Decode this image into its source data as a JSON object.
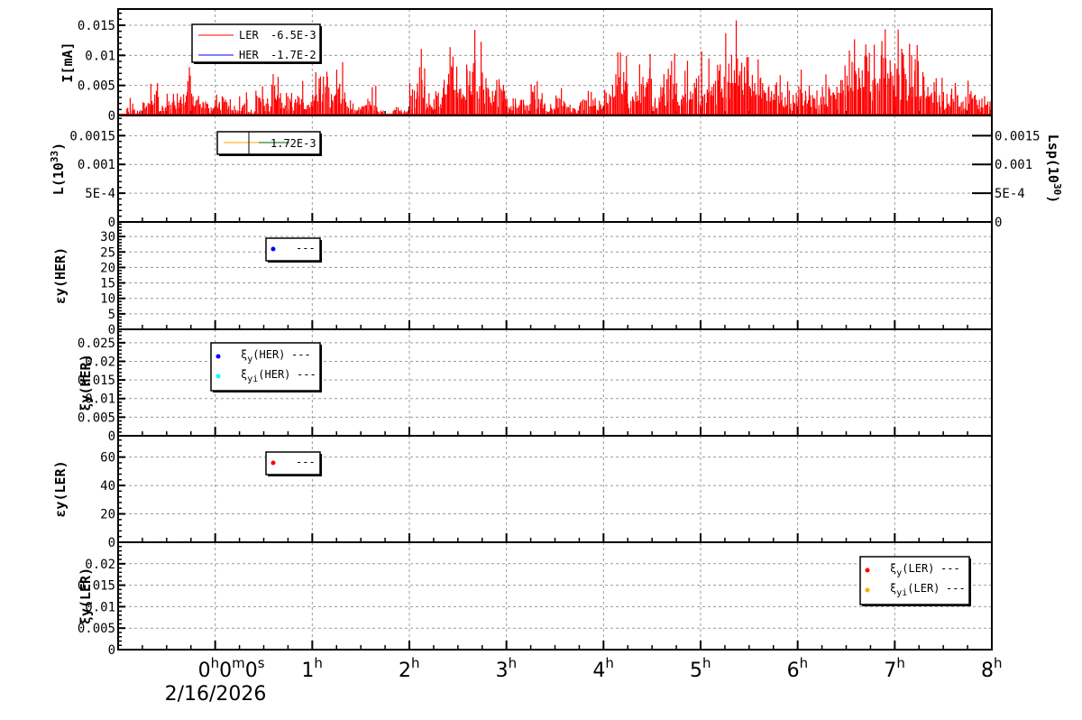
{
  "chart_data": [
    {
      "type": "bar",
      "ylabel": "I[mA]",
      "ylim": [
        0,
        0.0177
      ],
      "yticks": [
        "0",
        "0.005",
        "0.01",
        "0.015"
      ],
      "ytick_values": [
        0,
        0.005,
        0.01,
        0.015
      ],
      "legend": [
        {
          "name": "LER",
          "value": "-6.5E-3",
          "color": "#ff0000"
        },
        {
          "name": "HER",
          "value": "-1.7E-2",
          "color": "#0000ff"
        }
      ],
      "x_start_h": -1,
      "bin_minutes": 5,
      "values": [
        0,
        0.003,
        0.001,
        0.004,
        0.006,
        0.002,
        0.004,
        0.006,
        0.01,
        0.005,
        0.003,
        0.002,
        0.005,
        0.004,
        0.002,
        0.004,
        0.001,
        0.006,
        0.003,
        0.01,
        0.005,
        0.004,
        0.006,
        0.003,
        0.008,
        0.011,
        0.006,
        0.009,
        0.004,
        0.002,
        0.003,
        0.005,
        0.001,
        0,
        0.002,
        0.001,
        0.006,
        0.013,
        0.004,
        0.006,
        0.009,
        0.012,
        0.008,
        0.013,
        0.015,
        0.01,
        0.006,
        0.008,
        0.003,
        0.004,
        0.003,
        0.006,
        0.004,
        0.002,
        0.005,
        0.003,
        0.002,
        0.004,
        0.005,
        0.003,
        0.007,
        0.011,
        0.012,
        0.006,
        0.009,
        0.012,
        0.004,
        0.007,
        0.011,
        0.006,
        0.01,
        0.008,
        0.012,
        0.01,
        0.011,
        0.016,
        0.017,
        0.014,
        0.009,
        0.012,
        0.007,
        0.008,
        0.006,
        0.004,
        0.009,
        0.008,
        0.005,
        0.007,
        0.006,
        0.01,
        0.013,
        0.015,
        0.017,
        0.013,
        0.015,
        0.011,
        0.015,
        0.012,
        0.014,
        0.01,
        0.006,
        0.008,
        0.005,
        0.007,
        0.004,
        0.006,
        0.003,
        0.004
      ]
    },
    {
      "type": "line",
      "ylabel": "L(10",
      "ylabel_sup": "33",
      "ylabel_end": ")",
      "ylim": [
        0,
        0.00185
      ],
      "yticks": [
        "0",
        "5E-4",
        "0.001",
        "0.0015"
      ],
      "ytick_values": [
        0,
        0.0005,
        0.001,
        0.0015
      ],
      "ylabel_right": "Lsp(10",
      "ylabel_right_sup": "30",
      "ylabel_right_end": ")",
      "legend": [
        {
          "name": "",
          "value": "1.72E-3",
          "color": "#ffaa00"
        }
      ]
    },
    {
      "type": "scatter",
      "ylabel": "εy(HER)",
      "ylim": [
        0,
        34.7
      ],
      "yticks": [
        "0",
        "5",
        "10",
        "15",
        "20",
        "25",
        "30"
      ],
      "ytick_values": [
        0,
        5,
        10,
        15,
        20,
        25,
        30
      ],
      "legend": [
        {
          "name": "",
          "value": "---",
          "color": "#0000ff"
        }
      ]
    },
    {
      "type": "scatter",
      "ylabel": "ξy(HER)",
      "ylim": [
        0,
        0.0286
      ],
      "yticks": [
        "0",
        "0.005",
        "0.01",
        "0.015",
        "0.02",
        "0.025"
      ],
      "ytick_values": [
        0,
        0.005,
        0.01,
        0.015,
        0.02,
        0.025
      ],
      "legend": [
        {
          "name": "ξy(HER)",
          "value": "---",
          "color": "#0000ff"
        },
        {
          "name": "ξyi(HER)",
          "value": "---",
          "color": "#00ffff"
        }
      ]
    },
    {
      "type": "scatter",
      "ylabel": "εy(LER)",
      "ylim": [
        0,
        75
      ],
      "yticks": [
        "0",
        "20",
        "40",
        "60"
      ],
      "ytick_values": [
        0,
        20,
        40,
        60
      ],
      "legend": [
        {
          "name": "",
          "value": "---",
          "color": "#ff0000"
        }
      ]
    },
    {
      "type": "scatter",
      "ylabel": "ξy(LER)",
      "ylim": [
        0,
        0.025
      ],
      "yticks": [
        "0",
        "0.005",
        "0.01",
        "0.015",
        "0.02"
      ],
      "ytick_values": [
        0,
        0.005,
        0.01,
        0.015,
        0.02
      ],
      "legend": [
        {
          "name": "ξy(LER)",
          "value": "---",
          "color": "#ff0000"
        },
        {
          "name": "ξyi(LER)",
          "value": "---",
          "color": "#ffaa00"
        }
      ]
    }
  ],
  "xaxis": {
    "range_h": [
      -1,
      8
    ],
    "date": "2/16/2026",
    "ticks": [
      {
        "h": 0,
        "label": "0",
        "sup": "h",
        "rest": "0",
        "sup2": "m",
        "rest2": "0",
        "sup3": "s"
      },
      {
        "h": 1,
        "label": "1",
        "sup": "h"
      },
      {
        "h": 2,
        "label": "2",
        "sup": "h"
      },
      {
        "h": 3,
        "label": "3",
        "sup": "h"
      },
      {
        "h": 4,
        "label": "4",
        "sup": "h"
      },
      {
        "h": 5,
        "label": "5",
        "sup": "h"
      },
      {
        "h": 6,
        "label": "6",
        "sup": "h"
      },
      {
        "h": 7,
        "label": "7",
        "sup": "h"
      },
      {
        "h": 8,
        "label": "8",
        "sup": "h"
      }
    ]
  }
}
